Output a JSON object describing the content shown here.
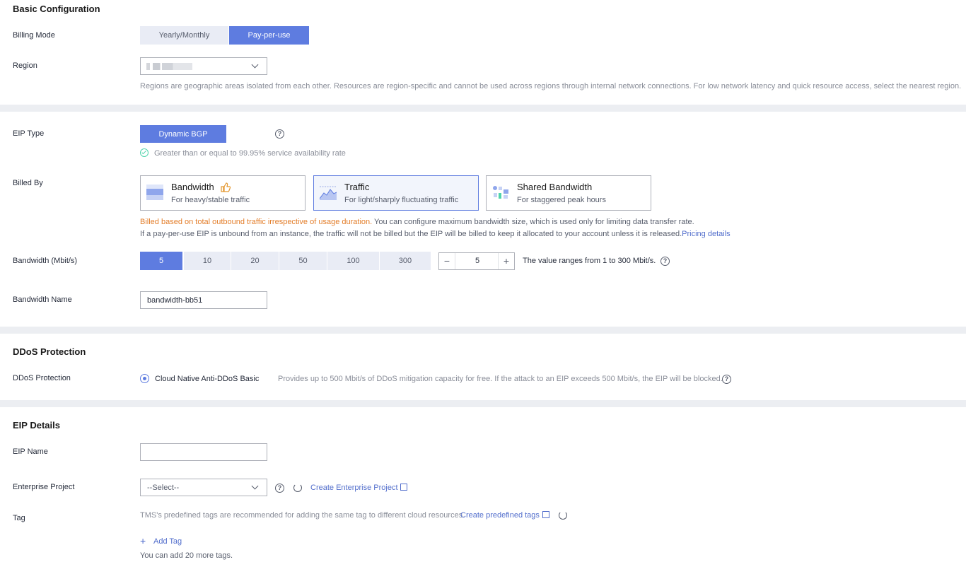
{
  "basic": {
    "title": "Basic Configuration",
    "billing_mode_label": "Billing Mode",
    "billing_options": [
      "Yearly/Monthly",
      "Pay-per-use"
    ],
    "billing_selected": "Pay-per-use",
    "region_label": "Region",
    "region_value": "",
    "region_hint": "Regions are geographic areas isolated from each other. Resources are region-specific and cannot be used across regions through internal network connections. For low network latency and quick resource access, select the nearest region."
  },
  "eip": {
    "type_label": "EIP Type",
    "type_value": "Dynamic BGP",
    "availability_text": "Greater than or equal to 99.95% service availability rate",
    "billed_by_label": "Billed By",
    "billed_cards": [
      {
        "title": "Bandwidth",
        "subtitle": "For heavy/stable traffic",
        "icon": "bandwidth-icon"
      },
      {
        "title": "Traffic",
        "subtitle": "For light/sharply fluctuating traffic",
        "icon": "traffic-icon"
      },
      {
        "title": "Shared Bandwidth",
        "subtitle": "For staggered peak hours",
        "icon": "shared-bandwidth-icon"
      }
    ],
    "billed_selected": "Traffic",
    "billed_note_highlight": "Billed based on total outbound traffic irrespective of usage duration.",
    "billed_note_rest": " You can configure maximum bandwidth size, which is used only for limiting data transfer rate.",
    "billed_note_line2": "If a pay-per-use EIP is unbound from an instance, the traffic will not be billed but the EIP will be billed to keep it allocated to your account unless it is released.",
    "pricing_link": "Pricing details",
    "bandwidth_label": "Bandwidth (Mbit/s)",
    "bandwidth_options": [
      "5",
      "10",
      "20",
      "50",
      "100",
      "300"
    ],
    "bandwidth_selected": "5",
    "bandwidth_value": "5",
    "bandwidth_range": "The value ranges from 1 to 300 Mbit/s.",
    "bandwidth_name_label": "Bandwidth Name",
    "bandwidth_name_value": "bandwidth-bb51"
  },
  "ddos": {
    "title": "DDoS Protection",
    "label": "DDoS Protection",
    "option": "Cloud Native Anti-DDoS Basic",
    "description": "Provides up to 500 Mbit/s of DDoS mitigation capacity for free. If the attack to an EIP exceeds 500 Mbit/s, the EIP will be blocked."
  },
  "details": {
    "title": "EIP Details",
    "name_label": "EIP Name",
    "name_value": "",
    "project_label": "Enterprise Project",
    "project_placeholder": "--Select--",
    "create_project_link": "Create Enterprise Project",
    "tag_label": "Tag",
    "tag_hint": "TMS's predefined tags are recommended for adding the same tag to different cloud resources.",
    "create_tags_link": "Create predefined tags",
    "add_tag": "Add Tag",
    "tags_remaining": "You can add 20 more tags."
  },
  "colors": {
    "accent": "#5e7ce0",
    "link": "#526ecc",
    "success": "#50d4ab",
    "warning": "#e37d29"
  }
}
